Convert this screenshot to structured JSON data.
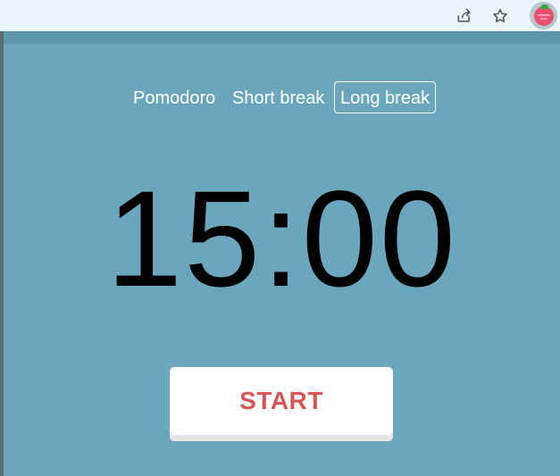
{
  "browser": {
    "icons": [
      "share-icon",
      "star-icon",
      "tomato-extension-icon"
    ]
  },
  "modes": [
    {
      "label": "Pomodoro",
      "active": false
    },
    {
      "label": "Short break",
      "active": false
    },
    {
      "label": "Long break",
      "active": true
    }
  ],
  "timer": {
    "display": "15:00"
  },
  "controls": {
    "start_label": "START"
  },
  "colors": {
    "background": "#6aa7bc",
    "start_text": "#d65656",
    "toolbar": "#e9f5f8"
  }
}
